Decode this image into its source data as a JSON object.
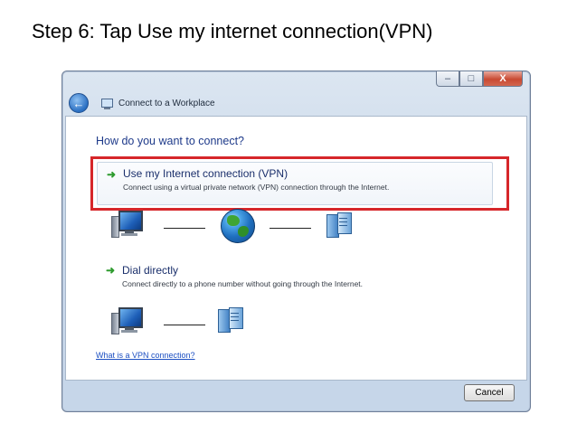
{
  "slide": {
    "title": "Step 6: Tap Use my internet connection(VPN)"
  },
  "window": {
    "title": "Connect to a Workplace",
    "controls": {
      "minimize": "–",
      "maximize": "□",
      "close": "X"
    }
  },
  "content": {
    "question": "How do you want to connect?",
    "options": [
      {
        "label": "Use my Internet connection (VPN)",
        "description": "Connect using a virtual private network (VPN) connection through the Internet.",
        "highlighted": true,
        "icons": [
          "computer-icon",
          "globe-icon",
          "server-icon"
        ]
      },
      {
        "label": "Dial directly",
        "description": "Connect directly to a phone number without going through the Internet.",
        "highlighted": false,
        "icons": [
          "computer-icon",
          "server-icon"
        ]
      }
    ],
    "help_link": "What is a VPN connection?"
  },
  "footer": {
    "cancel_label": "Cancel"
  },
  "colors": {
    "highlight": "#d6262a",
    "heading": "#1e3a8a",
    "arrow": "#2e9b2e",
    "link": "#1c4fc2"
  }
}
